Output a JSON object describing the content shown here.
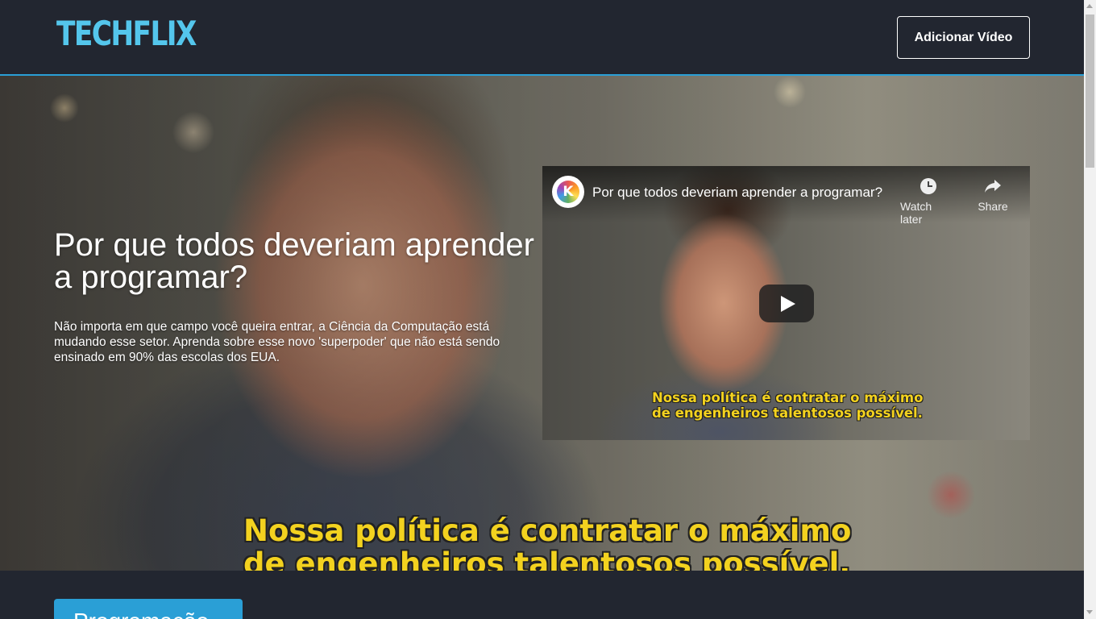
{
  "header": {
    "logo": "TECHFLIX",
    "add_video_label": "Adicionar Vídeo"
  },
  "banner": {
    "title": "Por que todos deveriam aprender a programar?",
    "description": "Não importa em que campo você queira entrar, a Ciência da Computação está mudando esse setor. Aprenda sobre esse novo 'superpoder' que não está sendo ensinado em 90% das escolas dos EUA.",
    "caption_line1": "Nossa política é contratar o máximo",
    "caption_line2": "de engenheiros talentosos possível."
  },
  "video": {
    "channel_initial": "K",
    "title": "Por que todos deveriam aprender a programar?",
    "watch_later_label": "Watch later",
    "share_label": "Share",
    "caption_line1": "Nossa política é contratar o máximo",
    "caption_line2": "de engenheiros talentosos possível."
  },
  "section": {
    "category_label": "Programação"
  },
  "colors": {
    "accent": "#2a9fd6",
    "logo": "#54c6ec",
    "caption": "#f3d21f",
    "header_bg": "#222630"
  }
}
